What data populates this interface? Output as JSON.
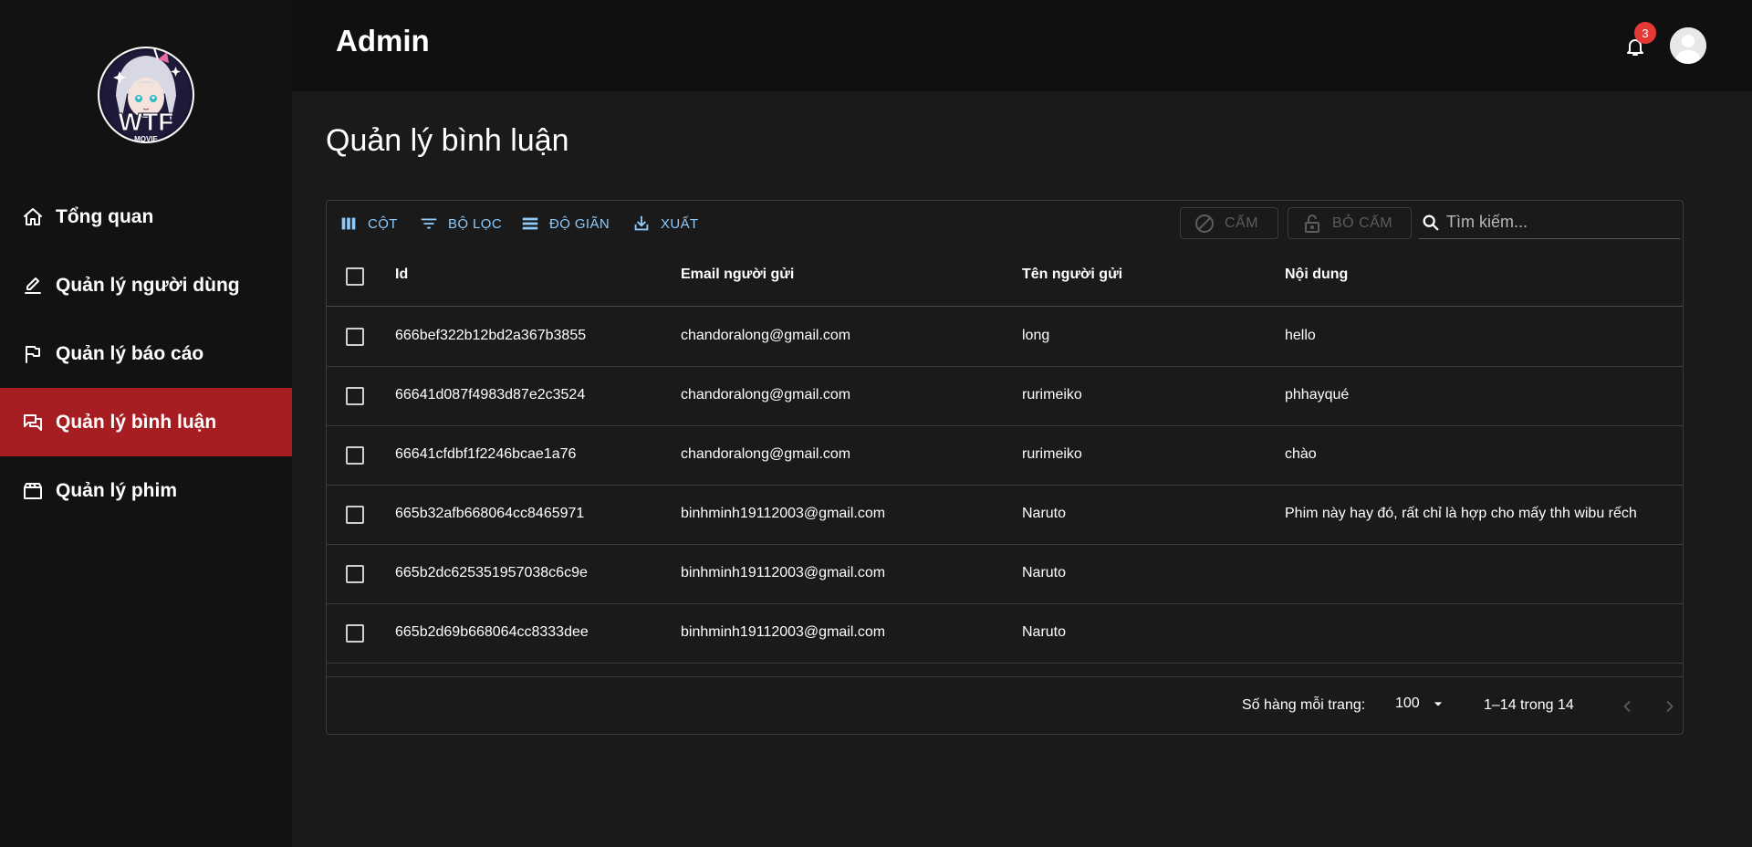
{
  "sidebar": {
    "logo": {
      "title": "WTF",
      "subtitle": "MOVIE"
    },
    "items": [
      {
        "label": "Tổng quan",
        "icon": "home-icon",
        "active": false
      },
      {
        "label": "Quản lý người dùng",
        "icon": "pencil-icon",
        "active": false
      },
      {
        "label": "Quản lý báo cáo",
        "icon": "flag-icon",
        "active": false
      },
      {
        "label": "Quản lý bình luận",
        "icon": "chat-icon",
        "active": true
      },
      {
        "label": "Quản lý phim",
        "icon": "movie-icon",
        "active": false
      }
    ]
  },
  "header": {
    "title": "Admin",
    "notification_count": "3"
  },
  "page": {
    "title": "Quản lý bình luận"
  },
  "toolbar": {
    "columns_label": "CỘT",
    "filter_label": "BỘ LỌC",
    "density_label": "ĐỘ GIÃN",
    "export_label": "XUẤT",
    "ban_label": "CẤM",
    "unban_label": "BỎ CẤM",
    "search_placeholder": "Tìm kiếm..."
  },
  "table": {
    "headers": [
      "Id",
      "Email người gửi",
      "Tên người gửi",
      "Nội dung"
    ],
    "rows": [
      [
        "666bef322b12bd2a367b3855",
        "chandoralong@gmail.com",
        "long",
        "hello"
      ],
      [
        "66641d087f4983d87e2c3524",
        "chandoralong@gmail.com",
        "rurimeiko",
        "phhayqué"
      ],
      [
        "66641cfdbf1f2246bcae1a76",
        "chandoralong@gmail.com",
        "rurimeiko",
        "chào"
      ],
      [
        "665b32afb668064cc8465971",
        "binhminh19112003@gmail.com",
        "Naruto",
        "Phim này hay đó, rất chỉ là hợp cho mấy thh wibu rếch"
      ],
      [
        "665b2dc625351957038c6c9e",
        "binhminh19112003@gmail.com",
        "Naruto",
        ""
      ],
      [
        "665b2d69b668064cc8333dee",
        "binhminh19112003@gmail.com",
        "Naruto",
        ""
      ]
    ]
  },
  "footer": {
    "rows_per_page_label": "Số hàng mỗi trang:",
    "rows_per_page_value": "100",
    "range_text": "1–14 trong 14"
  },
  "colors": {
    "accent": "#a61e22",
    "link": "#90caf9",
    "badge": "#e53935"
  }
}
